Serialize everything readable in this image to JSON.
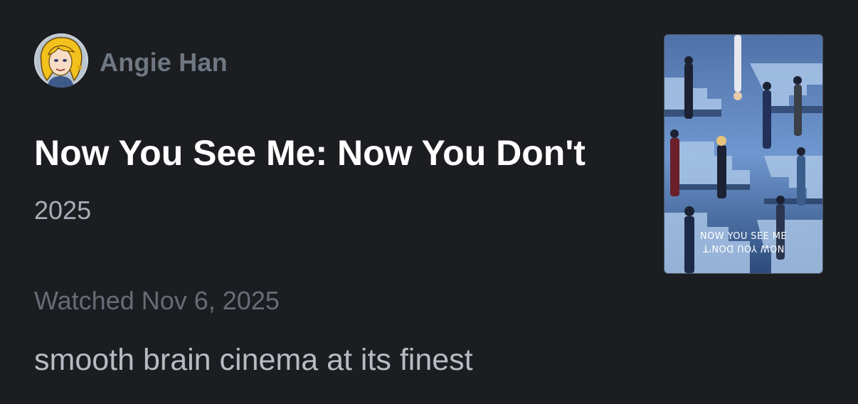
{
  "post": {
    "author_name": "Angie Han",
    "movie_title": "Now You See Me: Now You Don't",
    "year": "2025",
    "watched_label": "Watched Nov 6, 2025",
    "review_text": "smooth brain cinema at its finest"
  },
  "poster": {
    "line1": "NOW YOU SEE ME",
    "line2": "NOW YOU DON'T"
  },
  "colors": {
    "background": "#1b1d21",
    "title": "#ffffff",
    "author": "#6f7782",
    "year": "#a7adb5",
    "watched": "#666d76",
    "review": "#b7bcc3"
  }
}
